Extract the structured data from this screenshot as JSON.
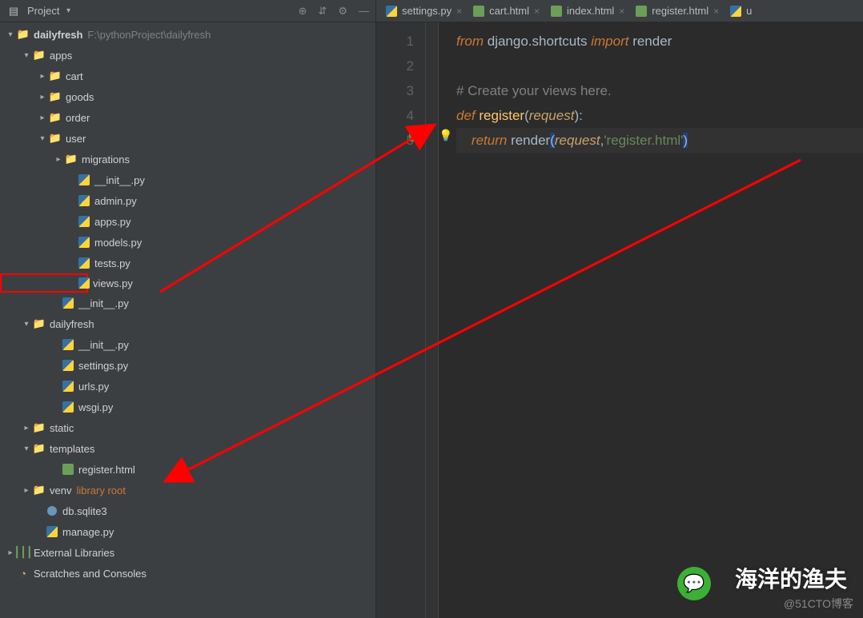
{
  "sidebar": {
    "title": "Project",
    "root": {
      "name": "dailyfresh",
      "path": "F:\\pythonProject\\dailyfresh"
    },
    "apps": {
      "label": "apps",
      "children": [
        "cart",
        "goods",
        "order"
      ],
      "user": {
        "label": "user",
        "migrations": "migrations",
        "files": [
          "__init__.py",
          "admin.py",
          "apps.py",
          "models.py",
          "tests.py",
          "views.py"
        ]
      },
      "init": "__init__.py"
    },
    "dailyfresh_pkg": {
      "label": "dailyfresh",
      "files": [
        "__init__.py",
        "settings.py",
        "urls.py",
        "wsgi.py"
      ]
    },
    "static": "static",
    "templates": {
      "label": "templates",
      "file": "register.html"
    },
    "venv": "venv",
    "venv_note": "library root",
    "db": "db.sqlite3",
    "manage": "manage.py",
    "ext_lib": "External Libraries",
    "scratches": "Scratches and Consoles"
  },
  "tabs": [
    {
      "label": "settings.py",
      "type": "py"
    },
    {
      "label": "cart.html",
      "type": "html"
    },
    {
      "label": "index.html",
      "type": "html"
    },
    {
      "label": "register.html",
      "type": "html"
    },
    {
      "label": "u",
      "type": "py"
    }
  ],
  "code": {
    "l1": {
      "from": "from",
      "mod": "django.shortcuts",
      "import": "import",
      "name": "render"
    },
    "l3": "# Create your views here.",
    "l4": {
      "def": "def",
      "fn": "register",
      "param": "request"
    },
    "l5": {
      "ret": "return",
      "call": "render",
      "param": "request",
      "str": "'register.html'"
    }
  },
  "watermark": {
    "title": "海洋的渔夫",
    "sub": "@51CTO博客"
  }
}
